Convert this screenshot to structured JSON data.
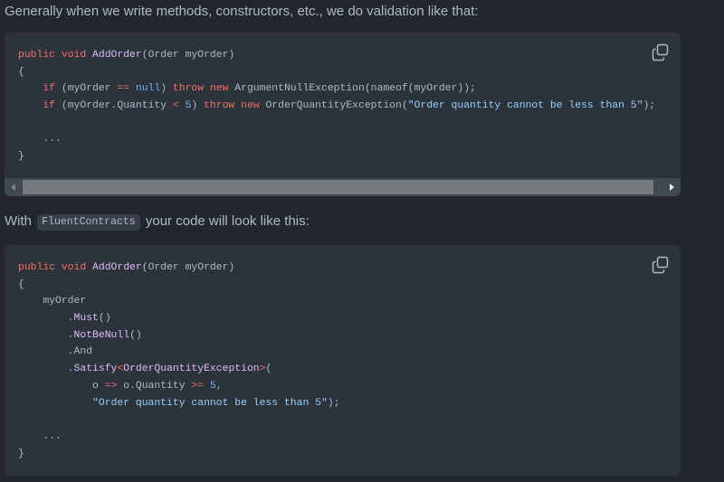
{
  "intro_text": "Generally when we write methods, constructors, etc., we do validation like that:",
  "second_para": {
    "before": "With",
    "code": "FluentContracts",
    "after": "your code will look like this:"
  },
  "code_block_1": {
    "lines": [
      [
        {
          "t": "public",
          "c": "kw"
        },
        {
          "t": " "
        },
        {
          "t": "void",
          "c": "kw"
        },
        {
          "t": " "
        },
        {
          "t": "AddOrder",
          "c": "fn"
        },
        {
          "t": "(Order myOrder)"
        }
      ],
      [
        {
          "t": "{"
        }
      ],
      [
        {
          "t": "    "
        },
        {
          "t": "if",
          "c": "kw"
        },
        {
          "t": " (myOrder "
        },
        {
          "t": "==",
          "c": "kw"
        },
        {
          "t": " "
        },
        {
          "t": "null",
          "c": "cn"
        },
        {
          "t": ") "
        },
        {
          "t": "throw",
          "c": "kw"
        },
        {
          "t": " "
        },
        {
          "t": "new",
          "c": "kw"
        },
        {
          "t": " ArgumentNullException(nameof(myOrder));"
        }
      ],
      [
        {
          "t": "    "
        },
        {
          "t": "if",
          "c": "kw"
        },
        {
          "t": " (myOrder.Quantity "
        },
        {
          "t": "<",
          "c": "kw"
        },
        {
          "t": " "
        },
        {
          "t": "5",
          "c": "cn"
        },
        {
          "t": ") "
        },
        {
          "t": "throw",
          "c": "kw"
        },
        {
          "t": " "
        },
        {
          "t": "new",
          "c": "kw"
        },
        {
          "t": " OrderQuantityException("
        },
        {
          "t": "\"Order quantity cannot be less than 5\"",
          "c": "st"
        },
        {
          "t": ");"
        }
      ],
      [
        {
          "t": ""
        }
      ],
      [
        {
          "t": "    ..."
        }
      ],
      [
        {
          "t": "}"
        }
      ]
    ]
  },
  "code_block_2": {
    "lines": [
      [
        {
          "t": "public",
          "c": "kw"
        },
        {
          "t": " "
        },
        {
          "t": "void",
          "c": "kw"
        },
        {
          "t": " "
        },
        {
          "t": "AddOrder",
          "c": "fn"
        },
        {
          "t": "(Order myOrder)"
        }
      ],
      [
        {
          "t": "{"
        }
      ],
      [
        {
          "t": "    myOrder"
        }
      ],
      [
        {
          "t": "        ."
        },
        {
          "t": "Must",
          "c": "fn"
        },
        {
          "t": "()"
        }
      ],
      [
        {
          "t": "        ."
        },
        {
          "t": "NotBeNull",
          "c": "fn"
        },
        {
          "t": "()"
        }
      ],
      [
        {
          "t": "        .And"
        }
      ],
      [
        {
          "t": "        ."
        },
        {
          "t": "Satisfy",
          "c": "fn"
        },
        {
          "t": "<",
          "c": "kw"
        },
        {
          "t": "OrderQuantityException",
          "c": "fn"
        },
        {
          "t": ">",
          "c": "kw"
        },
        {
          "t": "("
        }
      ],
      [
        {
          "t": "            o "
        },
        {
          "t": "=>",
          "c": "kw"
        },
        {
          "t": " o.Quantity "
        },
        {
          "t": ">=",
          "c": "kw"
        },
        {
          "t": " "
        },
        {
          "t": "5",
          "c": "cn"
        },
        {
          "t": ","
        }
      ],
      [
        {
          "t": "            "
        },
        {
          "t": "\"Order quantity cannot be less than 5\"",
          "c": "st"
        },
        {
          "t": ");"
        }
      ],
      [
        {
          "t": ""
        }
      ],
      [
        {
          "t": "    ..."
        }
      ],
      [
        {
          "t": "}"
        }
      ]
    ]
  },
  "icons": {
    "copy": "copy-icon",
    "scroll_left": "triangle-left-icon",
    "scroll_right": "triangle-right-icon"
  },
  "scroll_position": 0,
  "colors": {
    "page_bg": "#22272e",
    "code_bg": "#2d333b",
    "keyword": "#f47067",
    "function": "#dcbdfb",
    "constant": "#6cb6ff",
    "string": "#96d0ff"
  }
}
